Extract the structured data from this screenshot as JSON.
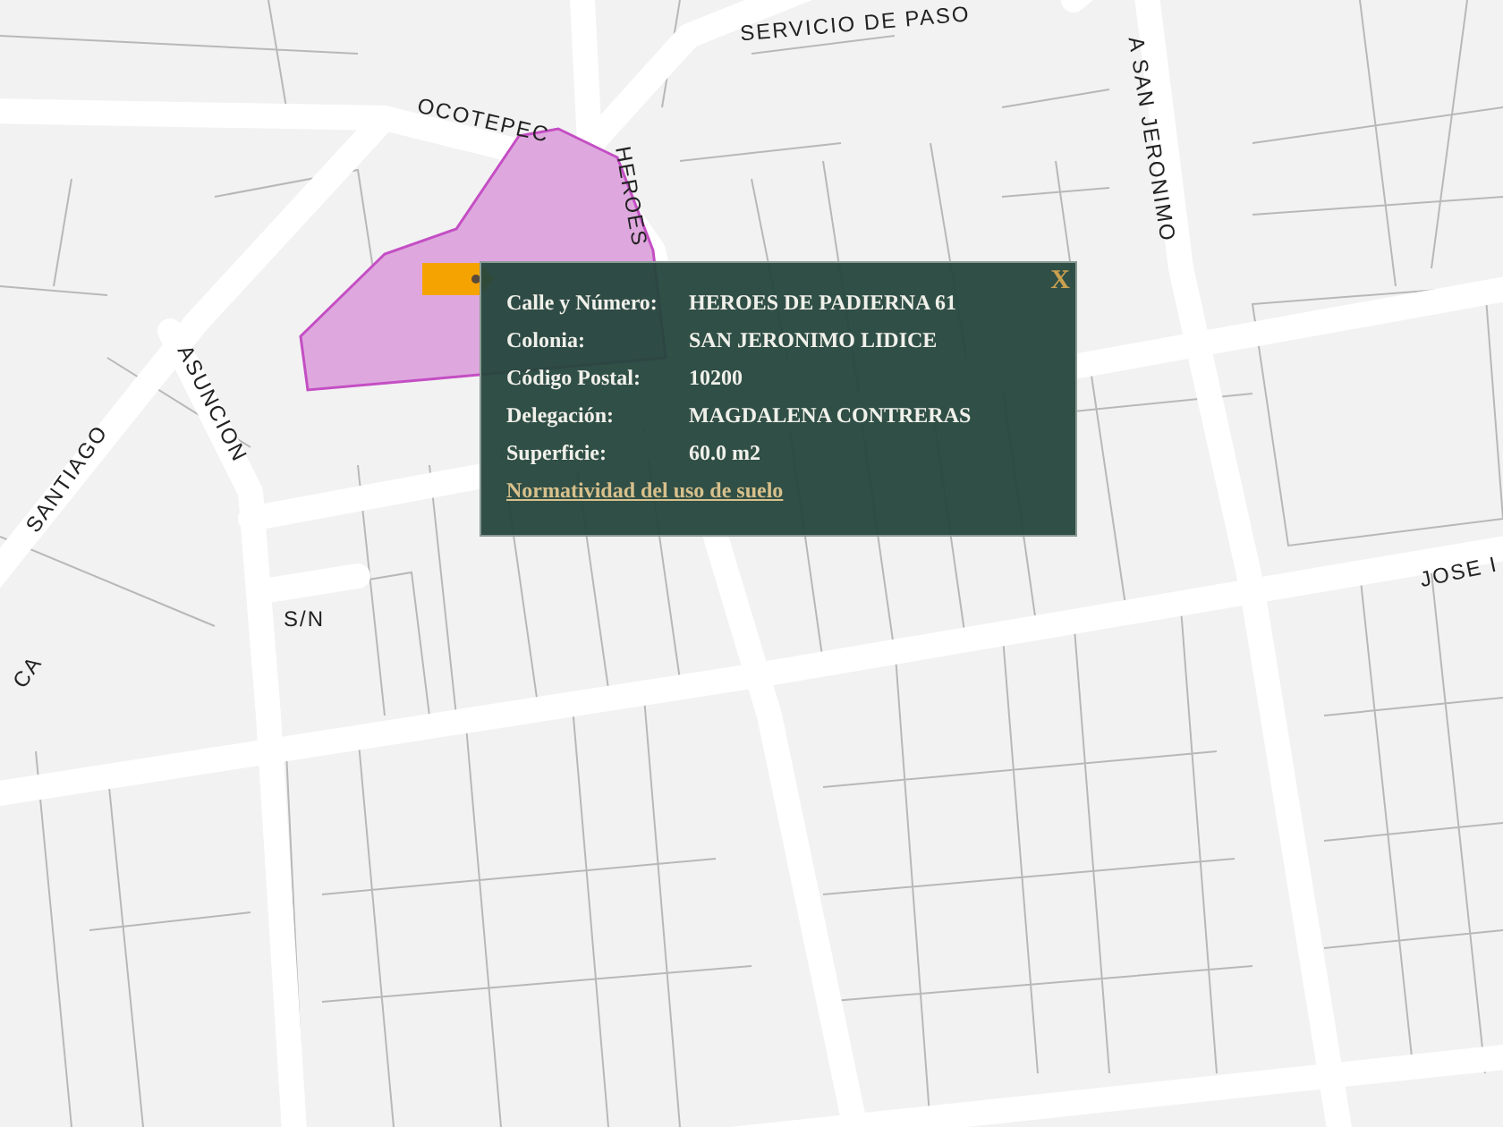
{
  "map": {
    "street_labels": [
      {
        "text": "SERVICIO DE PASO"
      },
      {
        "text": "A SAN JERONIMO"
      },
      {
        "text": "OCOTEPEC"
      },
      {
        "text": "HEROES"
      },
      {
        "text": "ASUNCION"
      },
      {
        "text": "SANTIAGO"
      },
      {
        "text": "S/N"
      },
      {
        "text": "JOSE I"
      },
      {
        "text": "CA"
      }
    ]
  },
  "popup": {
    "close": "X",
    "fields": [
      {
        "label": "Calle y Número:",
        "value": "HEROES DE PADIERNA 61"
      },
      {
        "label": "Colonia:",
        "value": "SAN JERONIMO LIDICE"
      },
      {
        "label": "Código Postal:",
        "value": "10200"
      },
      {
        "label": "Delegación:",
        "value": "MAGDALENA CONTRERAS"
      },
      {
        "label": "Superficie:",
        "value": "60.0 m2"
      }
    ],
    "link": "Normatividad del uso de suelo"
  }
}
